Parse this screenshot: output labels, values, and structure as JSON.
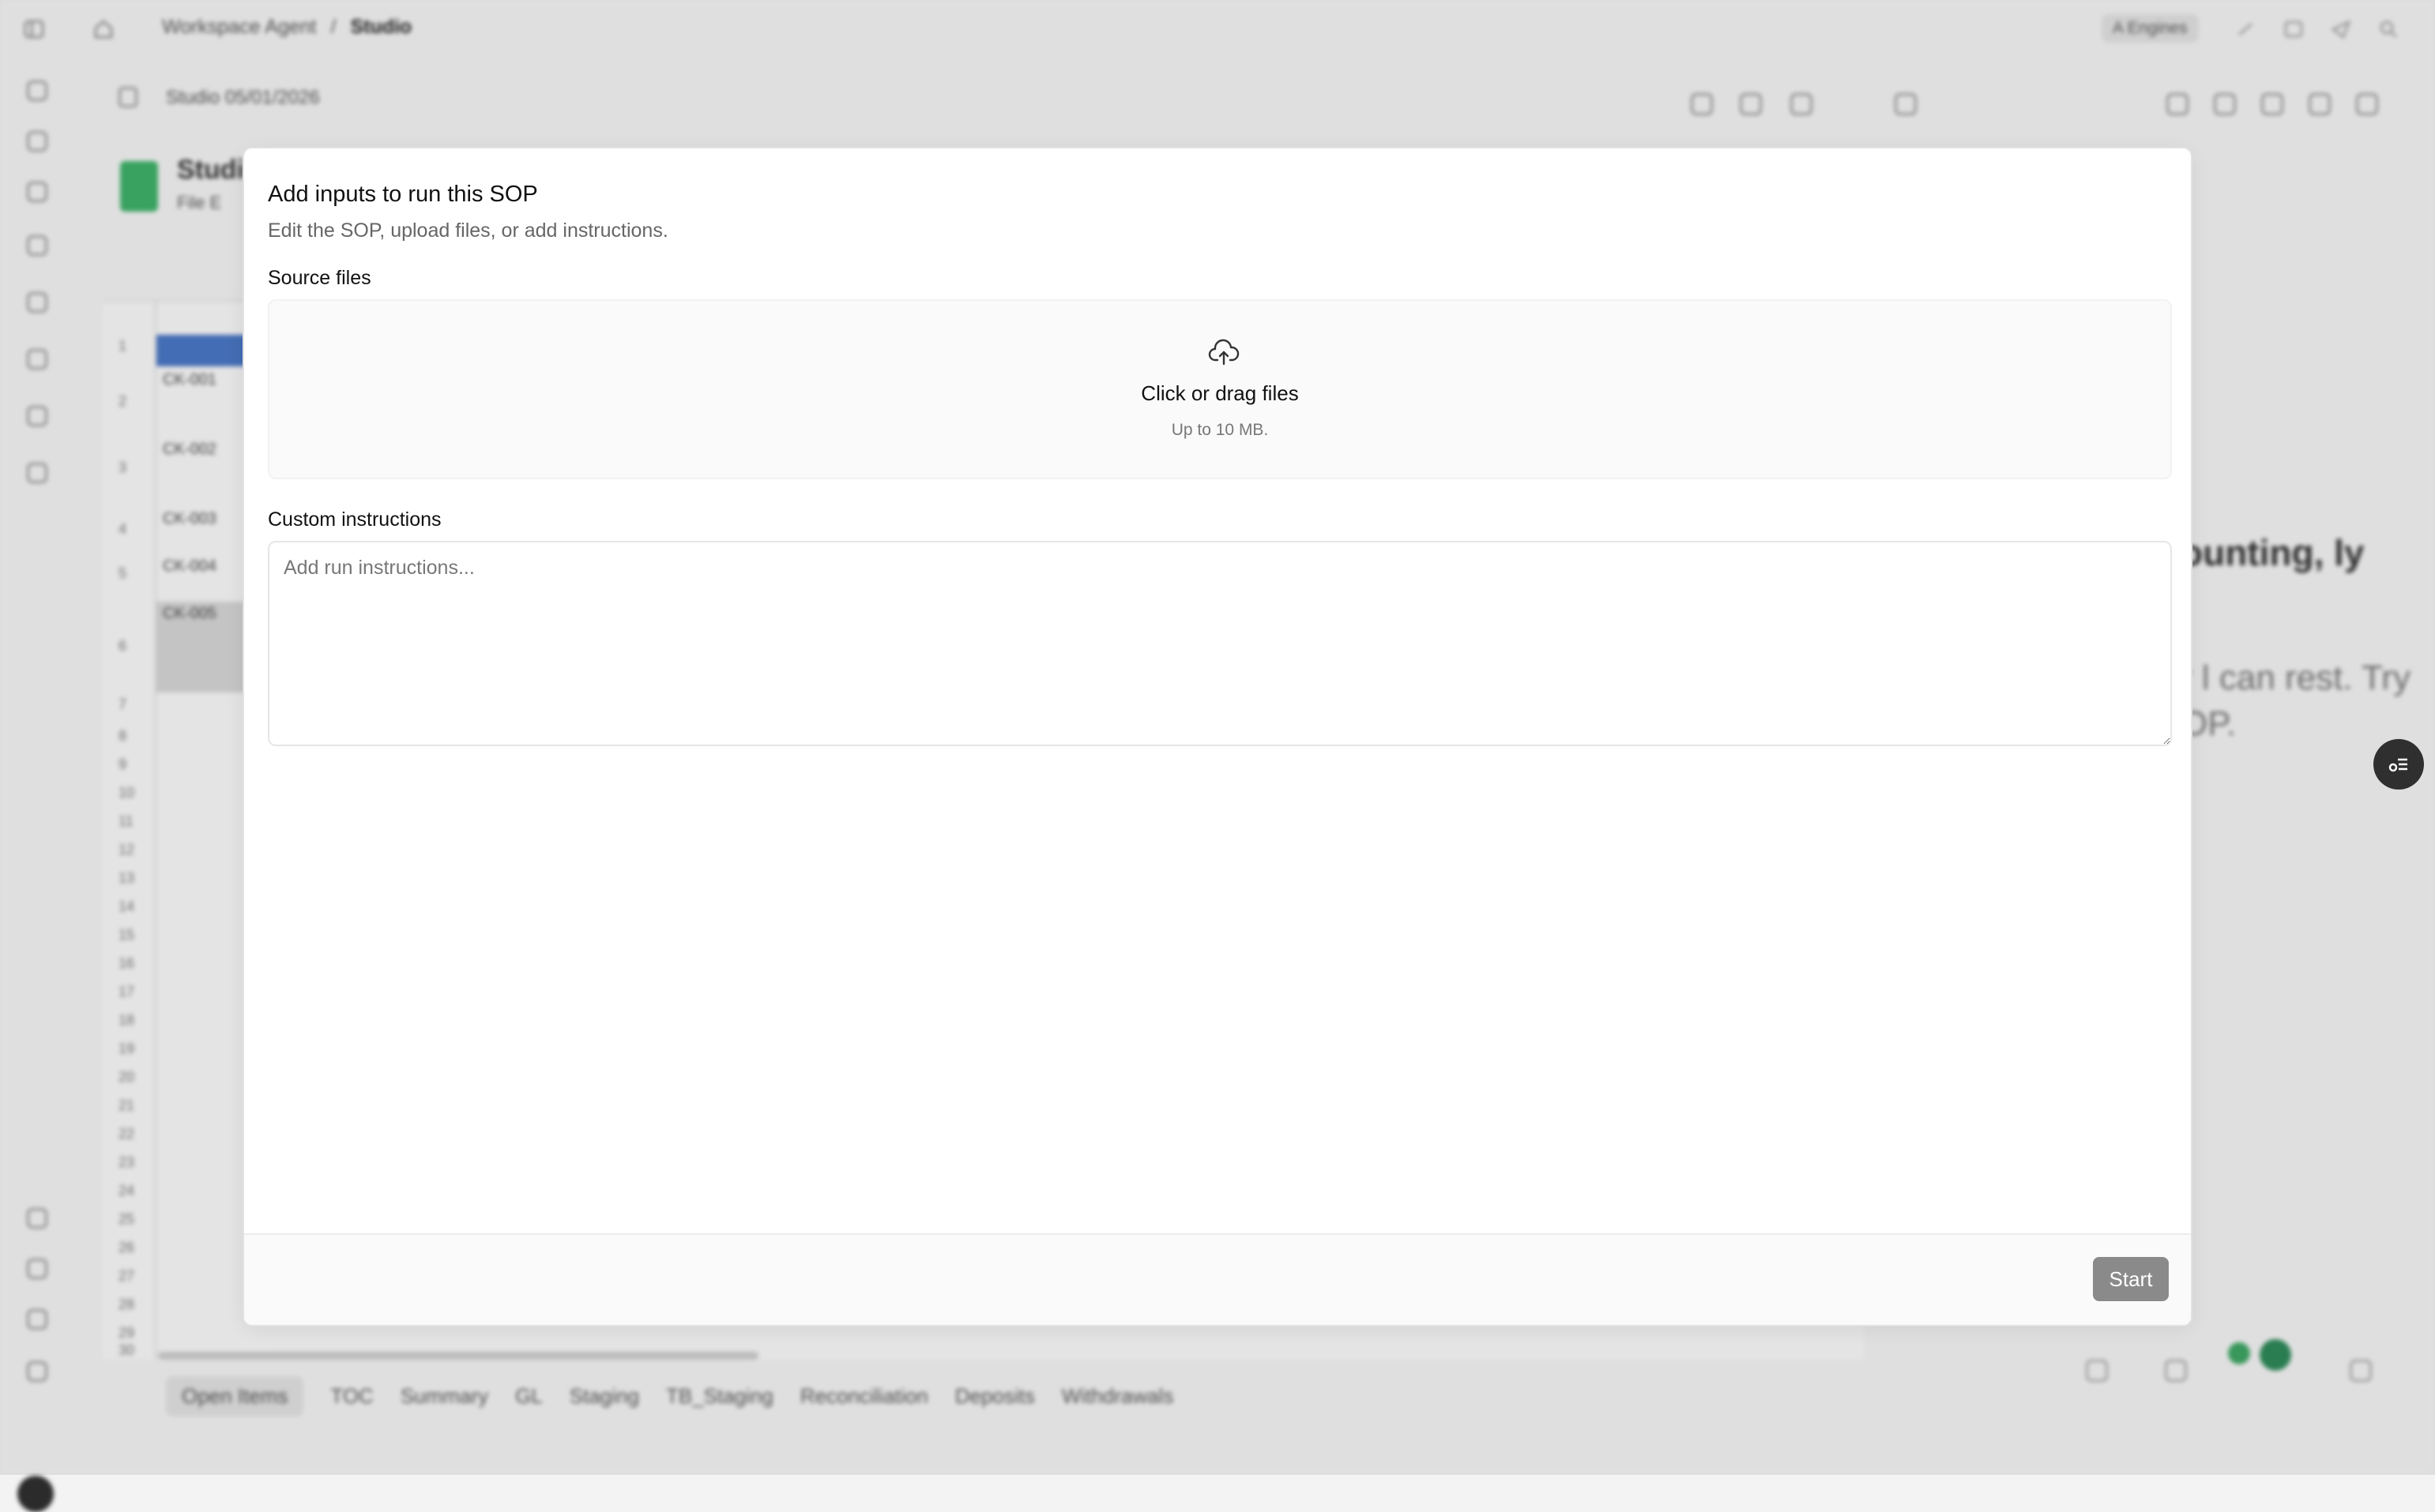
{
  "background": {
    "breadcrumb": [
      "Workspace Agent",
      "Studio"
    ],
    "top_badge": "A Engines",
    "file_name": "Studio 05/01/2026",
    "sheet": {
      "title": "Studio",
      "menu": "File   E",
      "row_numbers": [
        "1",
        "2",
        "3",
        "4",
        "5",
        "6",
        "7",
        "8",
        "9",
        "10",
        "11",
        "12",
        "13",
        "14",
        "15",
        "16",
        "17",
        "18",
        "19",
        "20",
        "21",
        "22",
        "23",
        "24",
        "25",
        "26",
        "27",
        "28",
        "29",
        "30"
      ],
      "col_a_values": [
        "CK-001",
        "CK-002",
        "CK-003",
        "CK-004",
        "CK-005"
      ]
    },
    "tabs": [
      "Open Items",
      "TOC",
      "Summary",
      "GL",
      "Staging",
      "TB_Staging",
      "Reconciliation",
      "Deposits",
      "Withdrawals"
    ],
    "right_panel": {
      "title_fragment": "ounting, ly",
      "text_fragment": "r l can rest. Try OP."
    }
  },
  "modal": {
    "title": "Add inputs to run this SOP",
    "subtitle": "Edit the SOP, upload files, or add instructions.",
    "source_files_label": "Source files",
    "dropzone_main": "Click or drag files",
    "dropzone_sub": "Up to 10 MB.",
    "custom_instructions_label": "Custom instructions",
    "instructions_placeholder": "Add run instructions...",
    "start_label": "Start"
  },
  "icons": {
    "upload": "cloud-upload-icon",
    "floating": "list-settings-icon"
  },
  "colors": {
    "start_button": "#8a8a8a",
    "floating_button": "#2f2f2f",
    "sheet_logo": "#3fb36a"
  }
}
